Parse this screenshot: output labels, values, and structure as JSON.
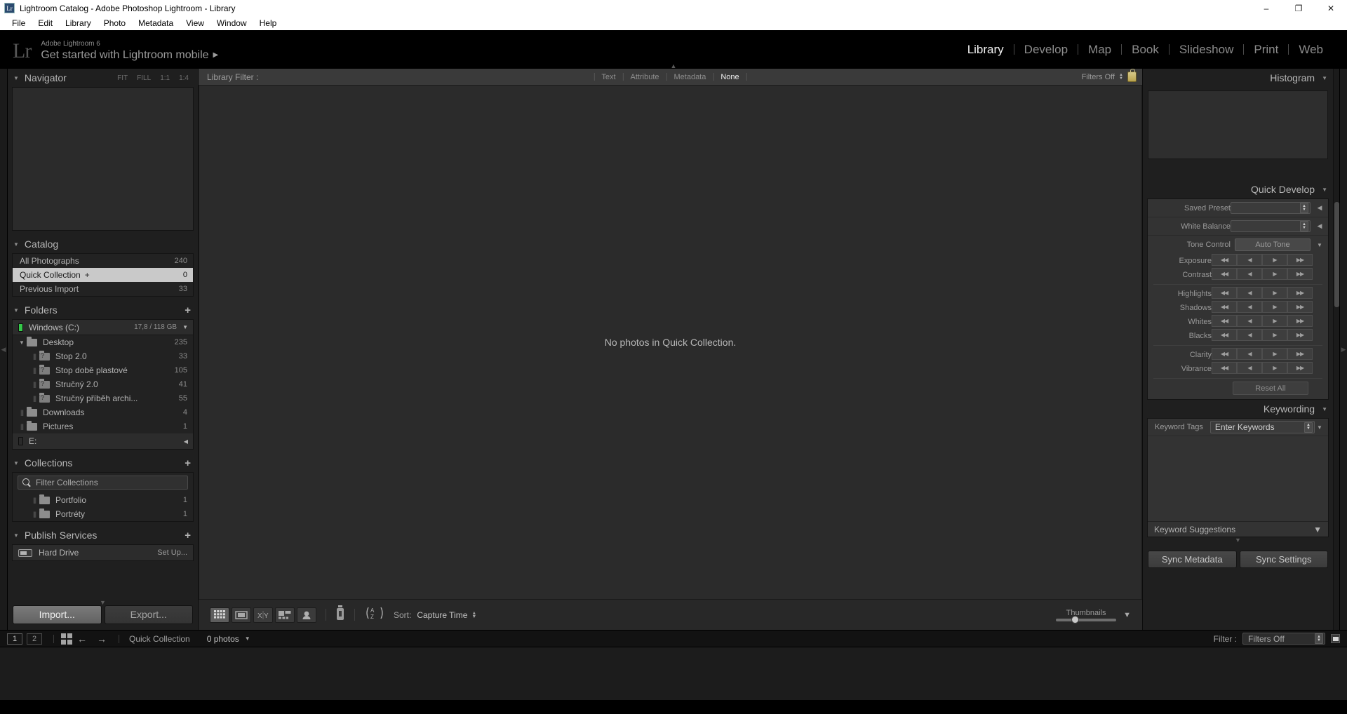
{
  "window": {
    "title": "Lightroom Catalog - Adobe Photoshop Lightroom - Library",
    "app_icon_label": "Lr",
    "minimize": "–",
    "maximize": "❐",
    "close": "✕"
  },
  "menubar": {
    "items": [
      "File",
      "Edit",
      "Library",
      "Photo",
      "Metadata",
      "View",
      "Window",
      "Help"
    ]
  },
  "identity": {
    "logo": "Lr",
    "subtitle": "Adobe Lightroom 6",
    "title": "Get started with Lightroom mobile",
    "arrow": "▶"
  },
  "modules": [
    {
      "label": "Library",
      "active": true
    },
    {
      "label": "Develop",
      "active": false
    },
    {
      "label": "Map",
      "active": false
    },
    {
      "label": "Book",
      "active": false
    },
    {
      "label": "Slideshow",
      "active": false
    },
    {
      "label": "Print",
      "active": false
    },
    {
      "label": "Web",
      "active": false
    }
  ],
  "navigator": {
    "title": "Navigator",
    "triangle": "▼",
    "modes": [
      "FIT",
      "FILL",
      "1:1",
      "1:4"
    ]
  },
  "catalog": {
    "title": "Catalog",
    "triangle": "▼",
    "items": [
      {
        "label": "All Photographs",
        "count": "240",
        "selected": false,
        "plus": ""
      },
      {
        "label": "Quick Collection",
        "count": "0",
        "selected": true,
        "plus": "+"
      },
      {
        "label": "Previous Import",
        "count": "33",
        "selected": false,
        "plus": ""
      }
    ]
  },
  "folders": {
    "title": "Folders",
    "triangle": "▼",
    "plus": "+",
    "drives": [
      {
        "name": "Windows (C:)",
        "space": "17,8 / 118 GB",
        "triangle": "▼",
        "led_on": true,
        "items": [
          {
            "label": "Desktop",
            "count": "235",
            "indent": 1,
            "twisty": "▼",
            "has_question": false
          },
          {
            "label": "Stop 2.0",
            "count": "33",
            "indent": 2,
            "twisty": "",
            "has_question": true
          },
          {
            "label": "Stop době plastové",
            "count": "105",
            "indent": 2,
            "twisty": "",
            "has_question": true
          },
          {
            "label": "Stručný 2.0",
            "count": "41",
            "indent": 2,
            "twisty": "",
            "has_question": true
          },
          {
            "label": "Stručný příběh archi...",
            "count": "55",
            "indent": 2,
            "twisty": "",
            "has_question": true
          },
          {
            "label": "Downloads",
            "count": "4",
            "indent": 1,
            "twisty": "",
            "has_question": false
          },
          {
            "label": "Pictures",
            "count": "1",
            "indent": 1,
            "twisty": "",
            "has_question": false
          }
        ]
      },
      {
        "name": "E:",
        "space": "",
        "triangle": "◀",
        "led_on": false,
        "items": []
      }
    ]
  },
  "collections": {
    "title": "Collections",
    "triangle": "▼",
    "plus": "+",
    "filter_placeholder": "Filter Collections",
    "items": [
      {
        "label": "Portfolio",
        "count": "1"
      },
      {
        "label": "Portréty",
        "count": "1"
      }
    ]
  },
  "publish_services": {
    "title": "Publish Services",
    "triangle": "▼",
    "plus": "+",
    "items": [
      {
        "label": "Hard Drive",
        "action": "Set Up..."
      }
    ]
  },
  "left_footer": {
    "import_label": "Import...",
    "export_label": "Export..."
  },
  "library_filter": {
    "label": "Library Filter :",
    "tabs": [
      {
        "label": "Text",
        "active": false
      },
      {
        "label": "Attribute",
        "active": false
      },
      {
        "label": "Metadata",
        "active": false
      },
      {
        "label": "None",
        "active": true
      }
    ],
    "filters_state": "Filters Off"
  },
  "grid": {
    "empty_message": "No photos in Quick Collection."
  },
  "center_toolbar": {
    "view_buttons": [
      "grid-view",
      "loupe-view",
      "compare-view",
      "survey-view",
      "people-view"
    ],
    "paint_tool": "spray-can",
    "sort_icon": "AZ",
    "sort_label": "Sort:",
    "sort_value": "Capture Time",
    "thumbnails_label": "Thumbnails"
  },
  "histogram": {
    "title": "Histogram",
    "triangle": "▼"
  },
  "quick_develop": {
    "title": "Quick Develop",
    "triangle": "▼",
    "saved_preset_label": "Saved Preset",
    "saved_preset_value": "",
    "white_balance_label": "White Balance",
    "white_balance_value": "",
    "tone_control_label": "Tone Control",
    "auto_tone_label": "Auto Tone",
    "sliders_group_1": [
      "Exposure",
      "Contrast"
    ],
    "sliders_group_2": [
      "Highlights",
      "Shadows",
      "Whites",
      "Blacks"
    ],
    "sliders_group_3": [
      "Clarity",
      "Vibrance"
    ],
    "reset_label": "Reset All",
    "btn_glyphs": [
      "◀◀",
      "◀",
      "▶",
      "▶▶"
    ]
  },
  "keywording": {
    "title": "Keywording",
    "triangle": "▼",
    "tags_label": "Keyword Tags",
    "tags_value": "Enter Keywords",
    "suggestions_label": "Keyword Suggestions",
    "suggestions_triangle": "▼"
  },
  "right_footer": {
    "sync_metadata_label": "Sync Metadata",
    "sync_settings_label": "Sync Settings"
  },
  "filmstrip_bar": {
    "page_1": "1",
    "page_2": "2",
    "back_arrow": "←",
    "forward_arrow": "→",
    "source_label": "Quick Collection",
    "photo_count": "0 photos",
    "count_caret": "▼",
    "filter_label": "Filter :",
    "filter_value": "Filters Off"
  },
  "colors": {
    "panel_bg": "#1f1f1f",
    "content_bg": "#2b2b2b",
    "accent_text": "#c9c9c9",
    "selected_row": "#c9c9c9",
    "drive_led": "#35c94a"
  }
}
